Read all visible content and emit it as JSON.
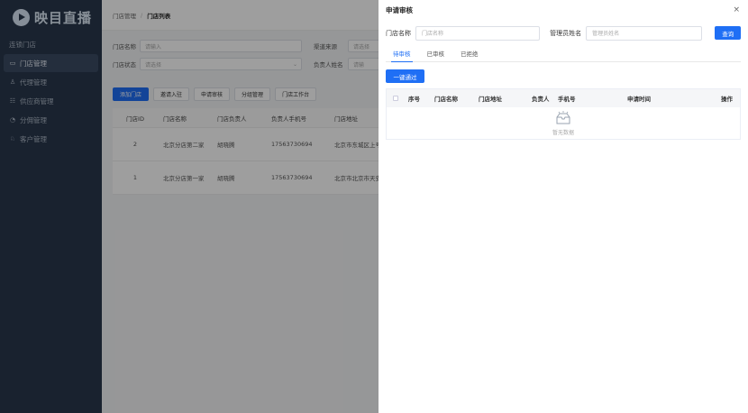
{
  "sidebar": {
    "logo_text": "映目直播",
    "group": "连锁门店",
    "items": [
      {
        "icon": "▭",
        "label": "门店管理",
        "active": true
      },
      {
        "icon": "♙",
        "label": "代理管理"
      },
      {
        "icon": "☷",
        "label": "供应商管理"
      },
      {
        "icon": "◔",
        "label": "分佣管理"
      },
      {
        "icon": "♘",
        "label": "客户管理"
      }
    ]
  },
  "breadcrumb": {
    "parent": "门店管理",
    "current": "门店列表"
  },
  "filters": {
    "name_label": "门店名称",
    "name_placeholder": "请输入",
    "source_label": "渠道来源",
    "source_placeholder": "请选择",
    "status_label": "门店状态",
    "status_placeholder": "请选择",
    "owner_label": "负责人姓名",
    "owner_placeholder": "请输"
  },
  "toolbar": {
    "add": "添加门店",
    "invite": "邀请入驻",
    "apply": "申请审核",
    "group": "分组管理",
    "workbench": "门店工作台"
  },
  "main_table": {
    "headers": [
      "门店ID",
      "门店名称",
      "门店负责人",
      "负责人手机号",
      "门店地址"
    ],
    "rows": [
      [
        "2",
        "北京分店第二家",
        "胡晓腾",
        "17563730694",
        "北京市东城区上号"
      ],
      [
        "1",
        "北京分店第一家",
        "胡晓腾",
        "17563730694",
        "北京市北京市天安"
      ]
    ]
  },
  "drawer": {
    "title": "申请审核",
    "close": "×",
    "store_label": "门店名称",
    "store_placeholder": "门店名称",
    "admin_label": "管理员姓名",
    "admin_placeholder": "管理员姓名",
    "query": "查询",
    "tabs": [
      "待审核",
      "已审核",
      "已拒绝"
    ],
    "pass_all": "一键通过",
    "headers": [
      "序号",
      "门店名称",
      "门店地址",
      "负责人",
      "手机号",
      "申请时间",
      "操作"
    ],
    "empty": "暂无数据"
  }
}
